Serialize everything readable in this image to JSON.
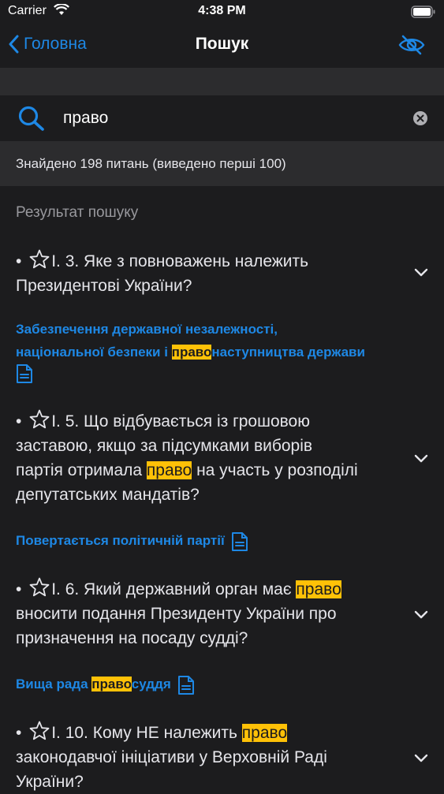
{
  "status_bar": {
    "carrier": "Carrier",
    "time": "4:38 PM"
  },
  "nav": {
    "back_label": "Головна",
    "title": "Пошук"
  },
  "search": {
    "value": "право"
  },
  "found_text": "Знайдено 198 питань (виведено перші 100)",
  "section_title": "Результат пошуку",
  "items": [
    {
      "question_line1": "I. 3. Яке з повноважень належить",
      "question_line2": "Президентові України?",
      "answer_line1": "Забезпечення державної незалежності,",
      "answer_line2_a": "національної безпеки і ",
      "answer_line2_hl": "право",
      "answer_line2_b": "наступництва держави"
    },
    {
      "question_line1": "I. 5. Що відбувається із грошовою",
      "question_line2": "заставою, якщо за підсумками виборів",
      "question_line3_a": "партія отримала ",
      "question_line3_hl": "право",
      "question_line3_b": " на участь у розподілі",
      "question_line4": "депутатських мандатів?",
      "answer": "Повертається політичній партії"
    },
    {
      "question_line1_a": "I. 6. Який державний орган має ",
      "question_line1_hl": "право",
      "question_line2": "вносити подання Президенту України про",
      "question_line3": "призначення на посаду судді?",
      "answer_a": "Вища рада ",
      "answer_hl": "право",
      "answer_b": "суддя"
    },
    {
      "question_line1_a": "I. 10. Кому НЕ належить ",
      "question_line1_hl": "право",
      "question_line2": "законодавчої ініціативи у Верховній Раді",
      "question_line3": "України?"
    }
  ],
  "colors": {
    "accent": "#1e88e5",
    "highlight": "#ffc107",
    "background": "#1c1c1e",
    "band": "#2c2c2e"
  }
}
